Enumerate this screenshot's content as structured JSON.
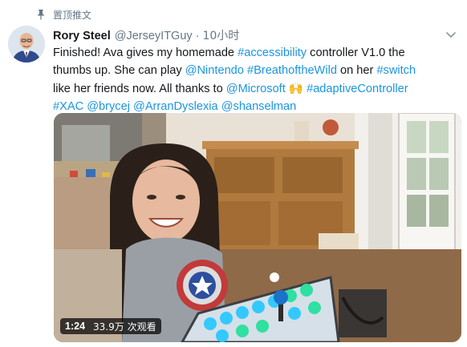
{
  "pinned_label": "置顶推文",
  "tweet": {
    "author_name": "Rory Steel",
    "author_handle": "@JerseyITGuy",
    "separator": "·",
    "timestamp": "10小时",
    "lines": [
      [
        {
          "text": "Finished! Ava gives my homemade ",
          "link": false
        },
        {
          "text": "#accessibility",
          "link": true
        },
        {
          "text": " controller V1.0 the",
          "link": false
        }
      ],
      [
        {
          "text": "thumbs up. She can play ",
          "link": false
        },
        {
          "text": "@Nintendo",
          "link": true
        },
        {
          "text": " ",
          "link": false
        },
        {
          "text": "#BreathoftheWild",
          "link": true
        },
        {
          "text": " on her ",
          "link": false
        },
        {
          "text": "#switch",
          "link": true
        }
      ],
      [
        {
          "text": " like her friends now. All thanks to ",
          "link": false
        },
        {
          "text": "@Microsoft",
          "link": true
        },
        {
          "text": " 🙌 ",
          "link": false
        },
        {
          "text": "#adaptiveController",
          "link": true
        }
      ],
      [
        {
          "text": "#XAC",
          "link": true
        },
        {
          "text": " ",
          "link": false
        },
        {
          "text": "@brycej",
          "link": true
        },
        {
          "text": " ",
          "link": false
        },
        {
          "text": "@ArranDyslexia",
          "link": true
        },
        {
          "text": " ",
          "link": false
        },
        {
          "text": "@shanselman",
          "link": true
        }
      ]
    ]
  },
  "video": {
    "duration": "1:24",
    "views": "33.9万 次观看"
  },
  "colors": {
    "link": "#1b95e0",
    "secondary_text": "#657786",
    "primary_text": "#14171a"
  },
  "icons": {
    "pin": "pin-icon",
    "caret": "chevron-down-icon",
    "avatar": "author-avatar"
  }
}
